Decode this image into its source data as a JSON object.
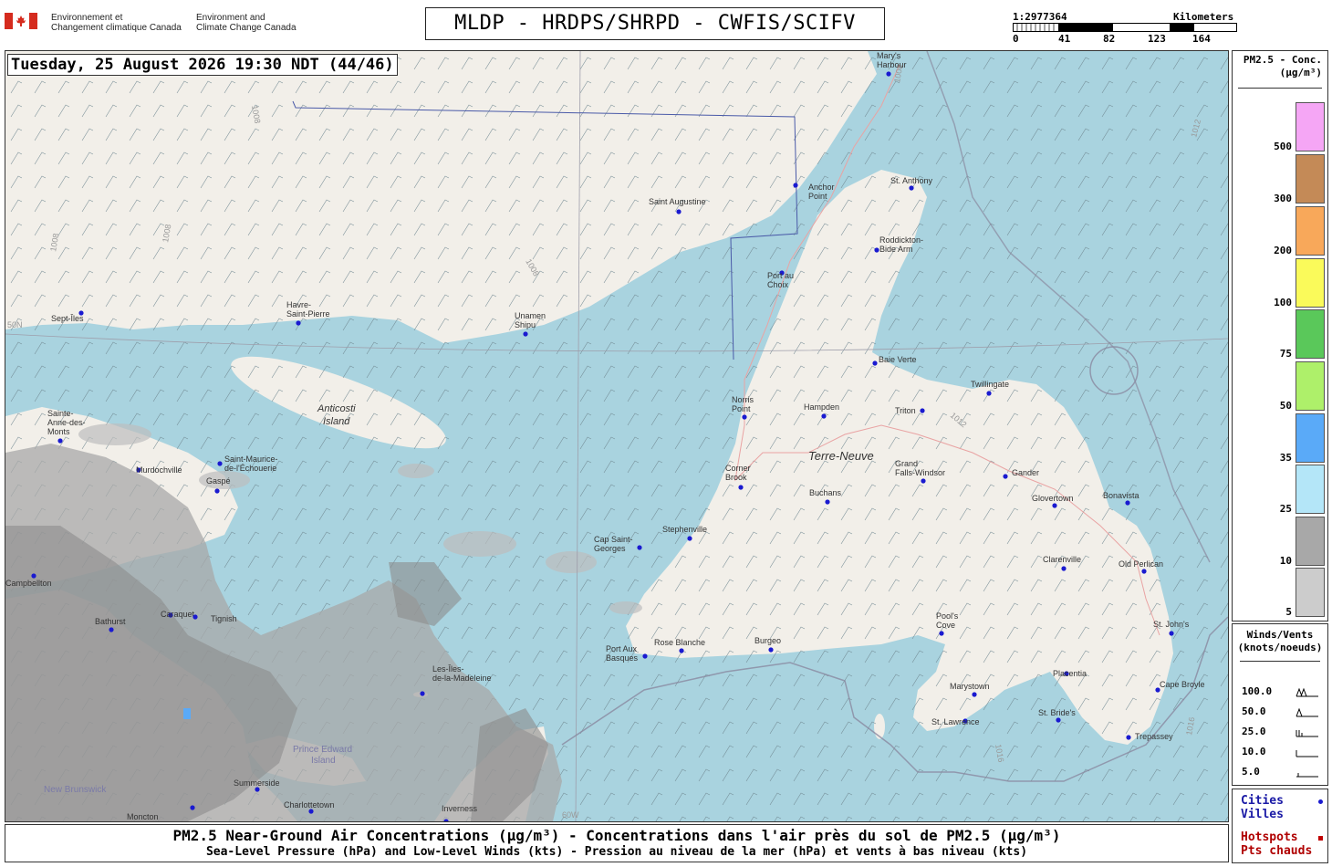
{
  "header": {
    "agency_fr_1": "Environnement et",
    "agency_fr_2": "Changement climatique Canada",
    "agency_en_1": "Environment and",
    "agency_en_2": "Climate Change Canada",
    "title": "MLDP - HRDPS/SHRPD - CWFIS/SCIFV",
    "scale_ratio": "1:2977364",
    "scale_unit": "Kilometers",
    "scale_ticks": [
      "0",
      "41",
      "82",
      "123",
      "164"
    ]
  },
  "timestamp": "Tuesday, 25 August 2026 19:30 NDT (44/46)",
  "legend": {
    "title_1": "PM2.5 - Conc.",
    "title_2": "(µg/m³)",
    "levels": [
      {
        "label": "500",
        "color": "#f5a6f5"
      },
      {
        "label": "300",
        "color": "#c48a57"
      },
      {
        "label": "200",
        "color": "#f8a85a"
      },
      {
        "label": "100",
        "color": "#fafa5a"
      },
      {
        "label": "75",
        "color": "#5ac85a"
      },
      {
        "label": "50",
        "color": "#aef06a"
      },
      {
        "label": "35",
        "color": "#5aaaf8"
      },
      {
        "label": "25",
        "color": "#b4e6f8"
      },
      {
        "label": "10",
        "color": "#a8a8a8"
      },
      {
        "label": "5",
        "color": "#cccccc"
      }
    ]
  },
  "winds": {
    "title_1": "Winds/Vents",
    "title_2": "(knots/noeuds)",
    "levels": [
      "100.0",
      "50.0",
      "25.0",
      "10.0",
      "5.0"
    ]
  },
  "markers": {
    "cities_en": "Cities",
    "cities_fr": "Villes",
    "hotspots_en": "Hotspots",
    "hotspots_fr": "Pts chauds",
    "city_color": "#1a1ad0",
    "hotspot_color": "#c00000"
  },
  "footer": {
    "line1": "PM2.5 Near-Ground Air Concentrations (µg/m³) - Concentrations dans l'air près du sol de PM2.5 (µg/m³)",
    "line2": "Sea-Level Pressure (hPa) and Low-Level Winds (kts) - Pression au niveau de la mer (hPa) et vents à bas niveau (kts)"
  },
  "map": {
    "water_color": "#a9d3df",
    "land_color": "#f2efe9",
    "smoke_color": "#a8a8a8",
    "regions": {
      "newfoundland": "Terre-Neuve",
      "anticosti_1": "Anticosti",
      "anticosti_2": "Island",
      "pei_1": "Prince Edward",
      "pei_2": "Island",
      "new_brunswick": "New Brunswick"
    },
    "latitude_label": "50N",
    "latitude_label_2": "60W",
    "isobar_label": "1008",
    "isobar_labels_alt": [
      "1012",
      "1016"
    ],
    "cities": [
      {
        "name": "Mary's",
        "name2": "Harbour"
      },
      {
        "name": "St. Anthony"
      },
      {
        "name": "Anchor",
        "name2": "Point"
      },
      {
        "name": "Saint Augustine"
      },
      {
        "name": "Roddickton-",
        "name2": "Bide Arm"
      },
      {
        "name": "Port au",
        "name2": "Choix"
      },
      {
        "name": "Sept-Îles"
      },
      {
        "name": "Havre-",
        "name2": "Saint-Pierre"
      },
      {
        "name": "Unamen",
        "name2": "Shipu"
      },
      {
        "name": "Baie Verte"
      },
      {
        "name": "Twillingate"
      },
      {
        "name": "Norris",
        "name2": "Point"
      },
      {
        "name": "Hampden"
      },
      {
        "name": "Triton"
      },
      {
        "name": "Sainte-",
        "name2": "Anne-des-",
        "name3": "Monts"
      },
      {
        "name": "Saint-Maurice-",
        "name2": "de-l'Échouerie"
      },
      {
        "name": "Murdochville"
      },
      {
        "name": "Gaspé"
      },
      {
        "name": "Corner",
        "name2": "Brook"
      },
      {
        "name": "Grand",
        "name2": "Falls-Windsor"
      },
      {
        "name": "Gander"
      },
      {
        "name": "Buchans"
      },
      {
        "name": "Glovertown"
      },
      {
        "name": "Bonavista"
      },
      {
        "name": "Stephenville"
      },
      {
        "name": "Cap Saint-",
        "name2": "Georges"
      },
      {
        "name": "Clarenville"
      },
      {
        "name": "Old Perlican"
      },
      {
        "name": "Campbellton"
      },
      {
        "name": "Bathurst"
      },
      {
        "name": "Caraquet"
      },
      {
        "name": "Pool's",
        "name2": "Cove"
      },
      {
        "name": "St. John's"
      },
      {
        "name": "Port Aux",
        "name2": "Basques"
      },
      {
        "name": "Rose Blanche"
      },
      {
        "name": "Burgeo"
      },
      {
        "name": "Les-Îles-",
        "name2": "de-la-Madeleine"
      },
      {
        "name": "Marystown"
      },
      {
        "name": "Placentia"
      },
      {
        "name": "Cape Broyle"
      },
      {
        "name": "Tignish"
      },
      {
        "name": "St. Lawrence"
      },
      {
        "name": "St. Bride's"
      },
      {
        "name": "Trepassey"
      },
      {
        "name": "Summerside"
      },
      {
        "name": "Charlottetown"
      },
      {
        "name": "Inverness"
      },
      {
        "name": "Moncton"
      }
    ]
  }
}
